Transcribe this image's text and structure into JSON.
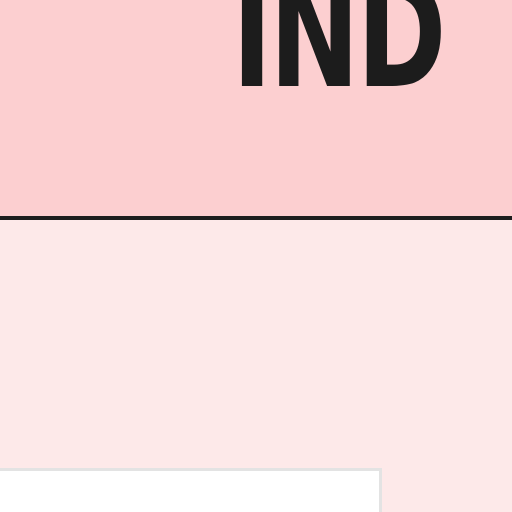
{
  "header": {
    "title_visible": "IND"
  },
  "colors": {
    "banner_bg": "#fccfd0",
    "content_bg": "#fde9e9",
    "title_text": "#1c1c1c",
    "divider": "#1d1d1d",
    "card_bg": "#ffffff",
    "card_border": "#e3e3e3"
  }
}
